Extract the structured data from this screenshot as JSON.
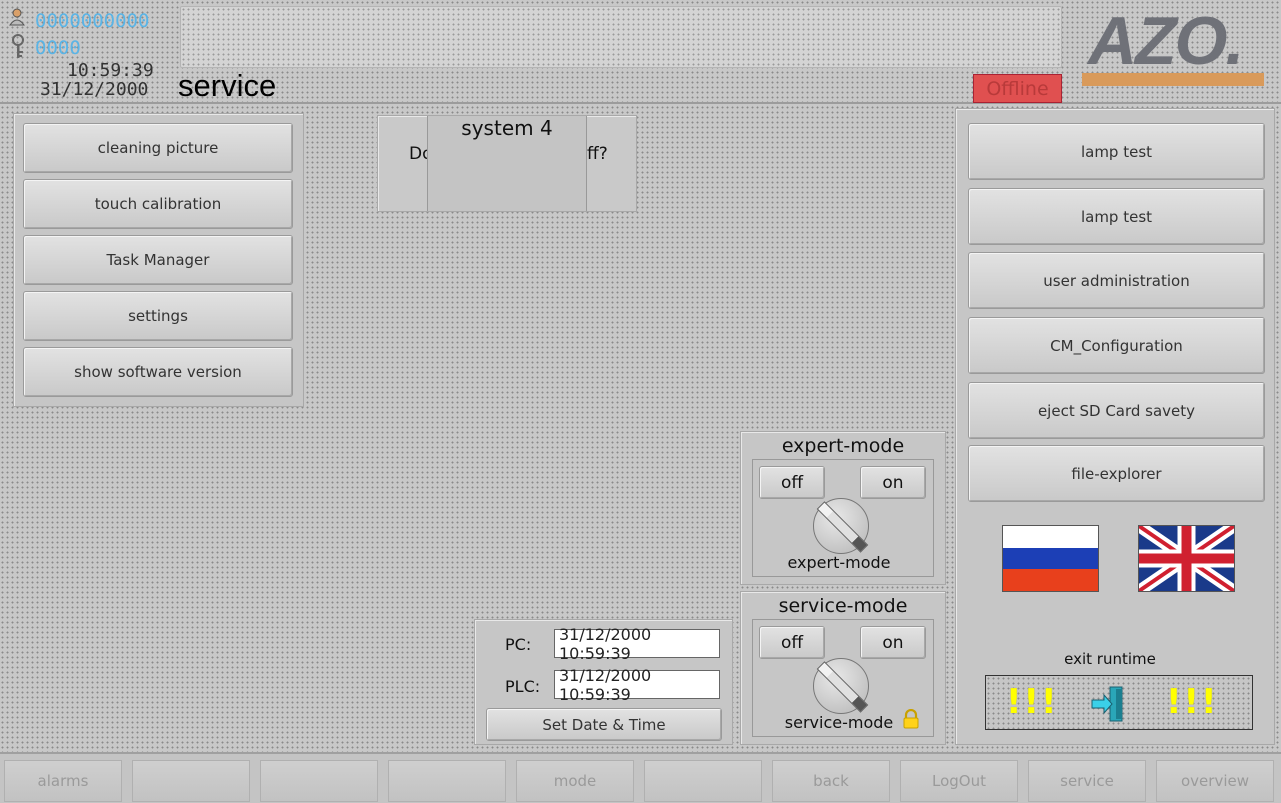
{
  "header": {
    "user_id": "0000000000",
    "key_id": "0000",
    "time": "10:59:39",
    "date": "31/12/2000",
    "page_title": "service",
    "status": "Offline",
    "logo": "AZO."
  },
  "left_menu": {
    "items": [
      "cleaning picture",
      "touch calibration",
      "Task Manager",
      "settings",
      "show software version"
    ]
  },
  "dialog": {
    "title": "system 4",
    "text_left": "Do",
    "text_right": "ff?"
  },
  "right_menu": {
    "items": [
      "lamp test",
      "lamp test",
      "user administration",
      "CM_Configuration",
      "eject SD Card savety",
      "file-explorer"
    ]
  },
  "languages": {
    "ru_icon": "flag-russia",
    "en_icon": "flag-uk"
  },
  "exit": {
    "label": "exit runtime",
    "warn_left": "!!!",
    "warn_right": "!!!"
  },
  "expert_mode": {
    "title": "expert-mode",
    "off": "off",
    "on": "on",
    "label": "expert-mode"
  },
  "service_mode": {
    "title": "service-mode",
    "off": "off",
    "on": "on",
    "label": "service-mode"
  },
  "datetime": {
    "pc_label": "PC:",
    "pc_value": "31/12/2000 10:59:39",
    "plc_label": "PLC:",
    "plc_value": "31/12/2000 10:59:39",
    "set_button": "Set Date & Time"
  },
  "nav": {
    "items": [
      "alarms",
      "",
      "",
      "",
      "mode",
      "",
      "back",
      "LogOut",
      "service",
      "overview"
    ]
  },
  "colors": {
    "status_bg": "#e05050",
    "logo_gray": "#6f7178",
    "logo_orange": "#d99a5a",
    "id_blue": "#5ab4e6",
    "warn_yellow": "#ffff00"
  }
}
